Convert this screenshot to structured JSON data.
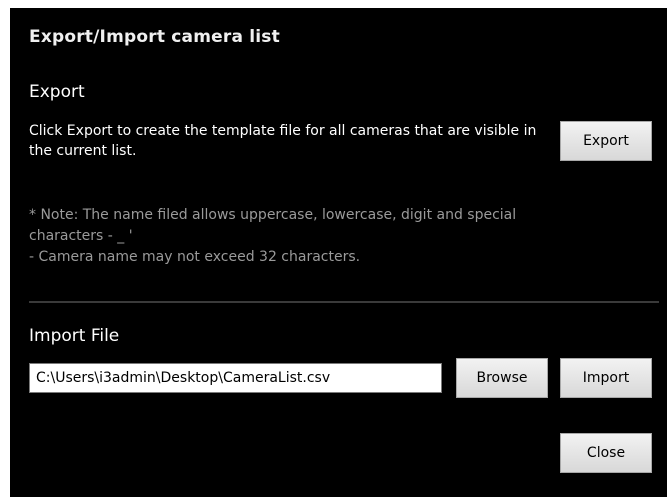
{
  "dialog": {
    "title": "Export/Import camera list"
  },
  "export": {
    "heading": "Export",
    "description": "Click Export to create the template file for all cameras that are visible in the current list.",
    "button_label": "Export",
    "note": "* Note: The name filed allows uppercase, lowercase, digit and special characters - _ '\n - Camera name may not exceed 32 characters."
  },
  "import": {
    "heading": "Import File",
    "file_path": "C:\\Users\\i3admin\\Desktop\\CameraList.csv",
    "browse_label": "Browse",
    "import_label": "Import"
  },
  "footer": {
    "close_label": "Close"
  }
}
